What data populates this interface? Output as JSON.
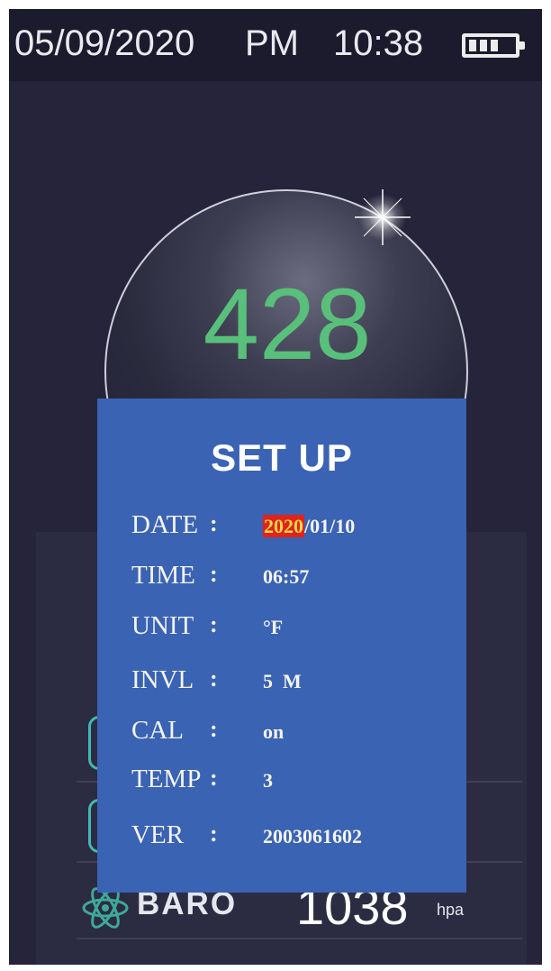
{
  "status": {
    "date": "05/09/2020",
    "ampm": "PM",
    "time": "10:38",
    "battery_icon": "battery-full-icon"
  },
  "reading": {
    "value": "428"
  },
  "setup": {
    "title": "SET UP",
    "rows": [
      {
        "label": "DATE",
        "colon": ":",
        "value_highlight": "2020",
        "value_rest": "/01/10"
      },
      {
        "label": "TIME",
        "colon": ":",
        "value": "06:57"
      },
      {
        "label": "UNIT",
        "colon": ":",
        "value": "°F"
      },
      {
        "label": "INVL",
        "colon": ":",
        "value": "5  M"
      },
      {
        "label": "CAL",
        "colon": ":",
        "value": "on"
      },
      {
        "label": "TEMP",
        "colon": ":",
        "value": "3"
      },
      {
        "label": "VER",
        "colon": ":",
        "value": "2003061602"
      }
    ]
  },
  "baro": {
    "icon": "atom-icon",
    "label": "BARO",
    "value": "1038",
    "unit": "hpa"
  },
  "colors": {
    "background": "#25243a",
    "panel": "#3a63b4",
    "reading": "#58c07a",
    "highlight_bg": "#e2231a",
    "highlight_text": "#f7d64a"
  }
}
